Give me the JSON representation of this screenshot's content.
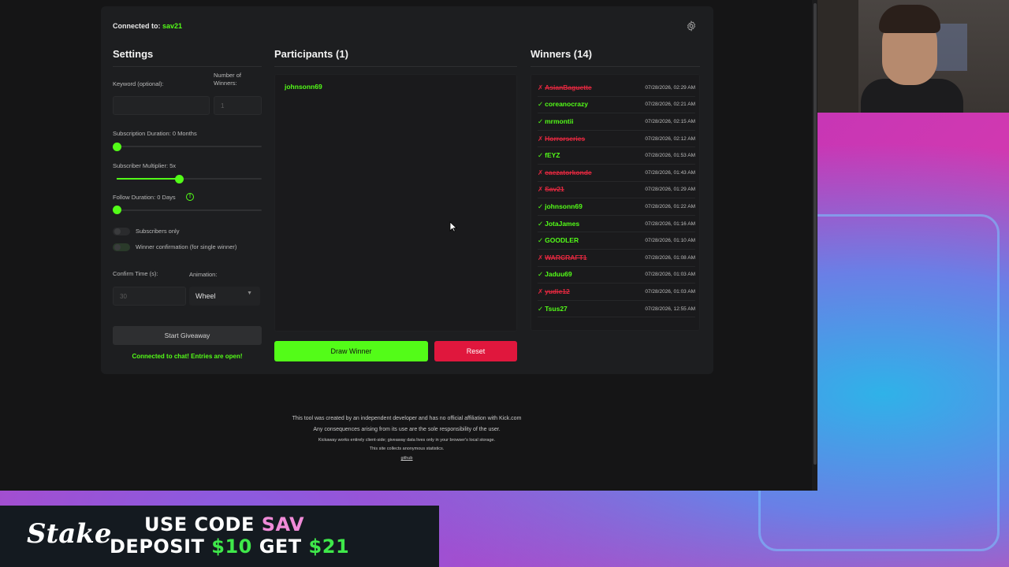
{
  "header": {
    "connected_label": "Connected to:",
    "connected_user": "sav21"
  },
  "settings": {
    "title": "Settings",
    "keyword_label": "Keyword (optional):",
    "keyword_value": "",
    "winners_label_1": "Number of",
    "winners_label_2": "Winners:",
    "winners_placeholder": "1",
    "sub_duration_label": "Subscription Duration: 0 Months",
    "sub_duration_value": 0,
    "sub_multiplier_label": "Subscriber Multiplier: 5x",
    "sub_multiplier_value": 0.42,
    "follow_duration_label": "Follow Duration:  0  Days",
    "follow_duration_value": 0,
    "info_icon_glyph": "!",
    "subscribers_only_label": "Subscribers only",
    "winner_confirmation_label": "Winner confirmation (for single winner)",
    "confirm_time_label": "Confirm Time (s):",
    "confirm_time_placeholder": "30",
    "animation_label": "Animation:",
    "animation_value": "Wheel",
    "start_button": "Start Giveaway",
    "status_text": "Connected to chat! Entries are open!"
  },
  "participants": {
    "title": "Participants (1)",
    "items": [
      "johnsonn69"
    ],
    "draw_button": "Draw Winner",
    "reset_button": "Reset"
  },
  "winners": {
    "title": "Winners (14)",
    "items": [
      {
        "name": "AsianBaguette",
        "status": "rejected",
        "mark": "✗",
        "time": "07/28/2026, 02:29 AM"
      },
      {
        "name": "coreanocrazy",
        "status": "confirmed",
        "mark": "✓",
        "time": "07/28/2026, 02:21 AM"
      },
      {
        "name": "mrmontii",
        "status": "confirmed",
        "mark": "✓",
        "time": "07/28/2026, 02:15 AM"
      },
      {
        "name": "Horrorseries",
        "status": "rejected",
        "mark": "✗",
        "time": "07/28/2026, 02:12 AM"
      },
      {
        "name": "fEYZ",
        "status": "confirmed",
        "mark": "✓",
        "time": "07/28/2026, 01:53 AM"
      },
      {
        "name": "caezatorkonde",
        "status": "rejected",
        "mark": "✗",
        "time": "07/28/2026, 01:43 AM"
      },
      {
        "name": "Sav21",
        "status": "rejected",
        "mark": "✗",
        "time": "07/28/2026, 01:29 AM"
      },
      {
        "name": "johnsonn69",
        "status": "confirmed",
        "mark": "✓",
        "time": "07/28/2026, 01:22 AM"
      },
      {
        "name": "JotaJames",
        "status": "confirmed",
        "mark": "✓",
        "time": "07/28/2026, 01:16 AM"
      },
      {
        "name": "GOODLER",
        "status": "confirmed",
        "mark": "✓",
        "time": "07/28/2026, 01:10 AM"
      },
      {
        "name": "WARCRAFT1",
        "status": "rejected",
        "mark": "✗",
        "time": "07/28/2026, 01:08 AM"
      },
      {
        "name": "Jaduu69",
        "status": "confirmed",
        "mark": "✓",
        "time": "07/28/2026, 01:03 AM"
      },
      {
        "name": "yudie12",
        "status": "rejected",
        "mark": "✗",
        "time": "07/28/2026, 01:03 AM"
      },
      {
        "name": "Tsus27",
        "status": "confirmed",
        "mark": "✓",
        "time": "07/28/2026, 12:55 AM"
      }
    ]
  },
  "footer": {
    "line1": "This tool was created by an independent developer and has no official affiliation with Kick.com",
    "line2": "Any consequences arising from its use are the sole responsibility of the user.",
    "line3": "Kickaway works entirely client-side; giveaway data lives only in your browser's local storage.",
    "line4": "This site collects anonymous statistics.",
    "link": "github"
  },
  "banner": {
    "logo": "Stake",
    "line1_a": "USE CODE ",
    "line1_b": "SAV",
    "line2_a": "DEPOSIT ",
    "line2_b": "$10",
    "line2_c": " GET ",
    "line2_d": "$21"
  },
  "colors": {
    "accent": "#53fc18",
    "danger": "#e0173d",
    "background": "#151516",
    "card": "#1d1e20"
  },
  "icons": [
    "gear-icon",
    "info-icon",
    "chevron-down-icon",
    "check-icon",
    "cross-icon",
    "mouse-cursor-icon"
  ]
}
